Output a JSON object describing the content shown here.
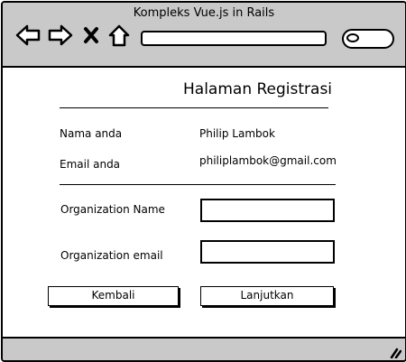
{
  "window": {
    "title": "Kompleks Vue.js in Rails"
  },
  "toolbar": {
    "back_icon": "back-arrow-icon",
    "forward_icon": "forward-arrow-icon",
    "close_icon": "close-x-icon",
    "home_icon": "home-icon",
    "url_value": "",
    "search_value": ""
  },
  "page": {
    "title": "Halaman Registrasi",
    "name_label": "Nama anda",
    "name_value": "Philip Lambok",
    "email_label": "Email anda",
    "email_value": "philiplambok@gmail.com",
    "org_name_label": "Organization Name",
    "org_name_value": "",
    "org_email_label": "Organization email",
    "org_email_value": "",
    "back_button": "Kembali",
    "next_button": "Lanjutkan"
  }
}
